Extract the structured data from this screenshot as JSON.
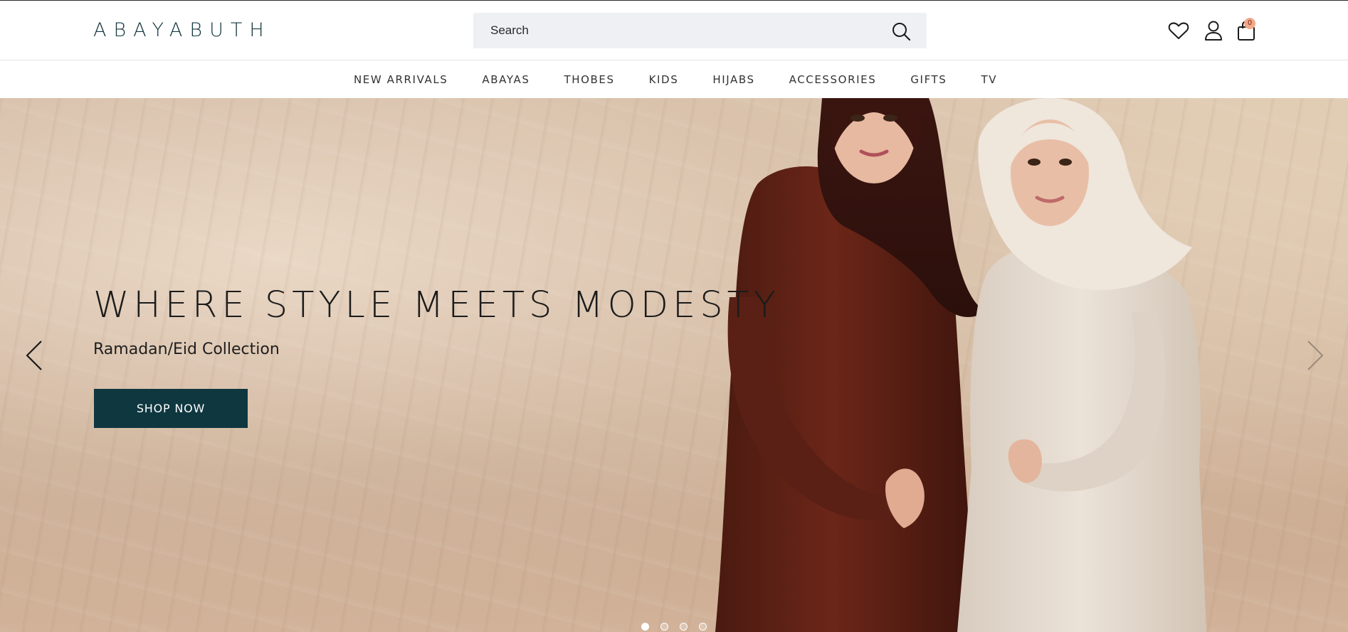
{
  "brand": {
    "logo_text": "ABAYABUTH"
  },
  "search": {
    "placeholder": "Search"
  },
  "header_icons": {
    "wishlist": "heart-icon",
    "account": "user-icon",
    "cart": "shopping-bag-icon",
    "cart_count": "0"
  },
  "nav": {
    "items": [
      {
        "label": "NEW ARRIVALS"
      },
      {
        "label": "ABAYAS"
      },
      {
        "label": "THOBES"
      },
      {
        "label": "KIDS"
      },
      {
        "label": "HIJABS"
      },
      {
        "label": "ACCESSORIES"
      },
      {
        "label": "GIFTS"
      },
      {
        "label": "TV"
      }
    ]
  },
  "hero": {
    "title": "WHERE STYLE MEETS MODESTY",
    "subtitle": "Ramadan/Eid Collection",
    "cta_label": "SHOP NOW",
    "slide_count": 4,
    "active_slide": 1
  },
  "colors": {
    "brand_dark": "#0f3740",
    "badge": "#f2a98a",
    "search_bg": "#eef0f4"
  }
}
